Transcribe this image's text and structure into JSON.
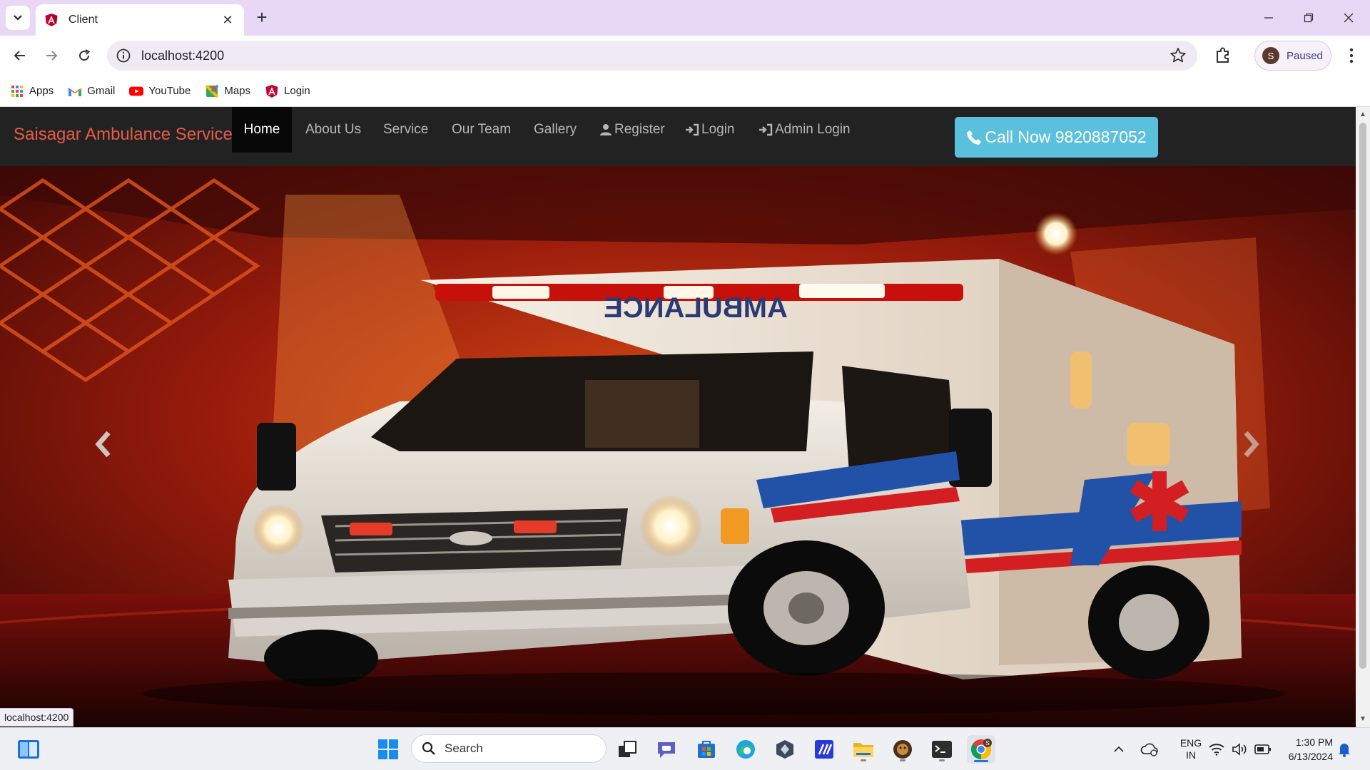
{
  "browser": {
    "tab_title": "Client",
    "url": "localhost:4200",
    "profile_initial": "S",
    "profile_status": "Paused",
    "status_bar_url": "localhost:4200"
  },
  "bookmarks": [
    {
      "label": "Apps",
      "icon": "apps-grid-icon"
    },
    {
      "label": "Gmail",
      "icon": "gmail-icon"
    },
    {
      "label": "YouTube",
      "icon": "youtube-icon"
    },
    {
      "label": "Maps",
      "icon": "maps-icon"
    },
    {
      "label": "Login",
      "icon": "angular-icon"
    }
  ],
  "site": {
    "brand": "Saisagar Ambulance Service",
    "nav": [
      {
        "label": "Home",
        "active": true
      },
      {
        "label": "About Us"
      },
      {
        "label": "Service"
      },
      {
        "label": "Our Team"
      },
      {
        "label": "Gallery"
      },
      {
        "label": "Register",
        "icon": "user-icon"
      },
      {
        "label": "Login",
        "icon": "log-in-icon"
      },
      {
        "label": "Admin Login",
        "icon": "log-in-icon"
      }
    ],
    "call_button": "Call Now 9820887052",
    "hero_vehicle_text": "AMBULANCE",
    "colors": {
      "brand": "#ea5a47",
      "navbar": "#222222",
      "call_button": "#5bc0de"
    }
  },
  "taskbar": {
    "search_placeholder": "Search",
    "language_top": "ENG",
    "language_bottom": "IN",
    "time": "1:30 PM",
    "date": "6/13/2024"
  }
}
